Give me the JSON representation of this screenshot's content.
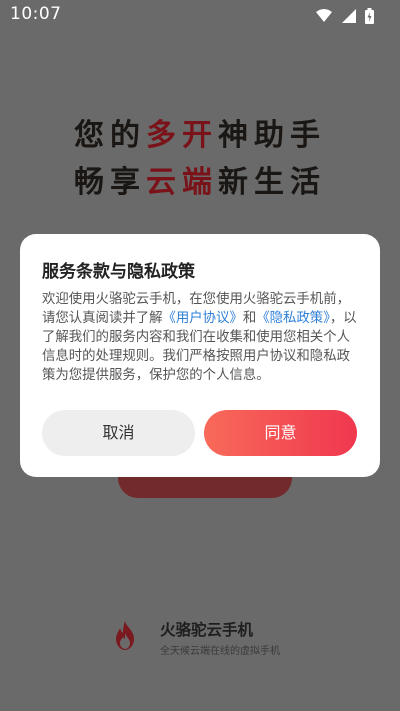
{
  "status_bar": {
    "time": "10:07"
  },
  "slogan": {
    "line1_a": "您的",
    "line1_hl": "多开",
    "line1_b": "神助手",
    "line2_a": "畅享",
    "line2_hl": "云端",
    "line2_b": "新生活"
  },
  "dialog": {
    "title": "服务条款与隐私政策",
    "body_1": "欢迎使用火骆驼云手机，在您使用火骆驼云手机前，请您认真阅读并了解",
    "link_user_agreement": "《用户协议》",
    "body_2": "和",
    "link_privacy_policy": "《隐私政策》",
    "body_3": "，以了解我们的服务内容和我们在收集和使用您相关个人信息时的处理规则。我们严格按照用户协议和隐私政策为您提供服务，保护您的个人信息。",
    "cancel_label": "取消",
    "agree_label": "同意"
  },
  "footer": {
    "brand_name": "火骆驼云手机",
    "brand_tagline": "全天候云端在线的虚拟手机"
  },
  "colors": {
    "accent": "#f0374f",
    "slogan_highlight": "#7a1219",
    "link": "#2f7fd8"
  }
}
